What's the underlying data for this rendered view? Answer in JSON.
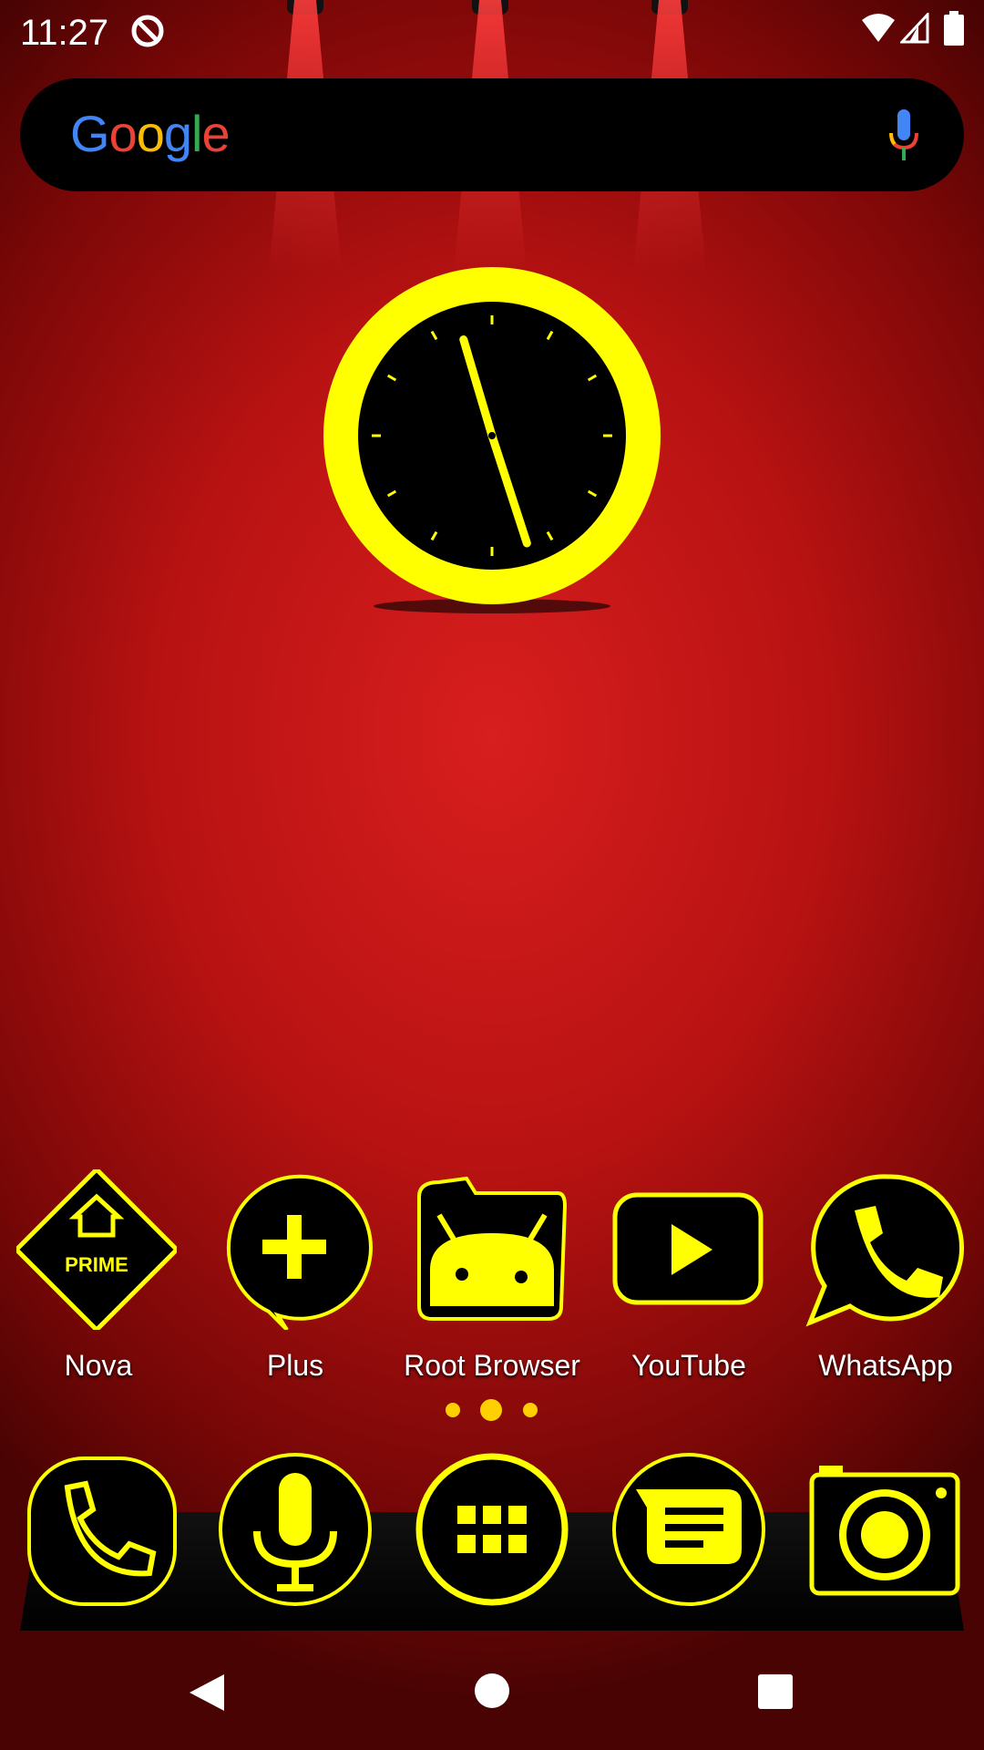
{
  "status_bar": {
    "time": "11:27",
    "notification_icon": "q-badge-icon",
    "icons": [
      "wifi-icon",
      "signal-icon",
      "battery-icon"
    ]
  },
  "search": {
    "logo": "Google",
    "mic_icon": "mic-icon"
  },
  "clock": {
    "hour": 11,
    "minute": 27,
    "ring_color": "#ffff00",
    "face_color": "#000000"
  },
  "apps": [
    {
      "label": "Nova",
      "icon": "nova-prime-icon"
    },
    {
      "label": "Plus",
      "icon": "plus-icon"
    },
    {
      "label": "Root Browser",
      "icon": "root-browser-icon"
    },
    {
      "label": "YouTube",
      "icon": "youtube-icon"
    },
    {
      "label": "WhatsApp",
      "icon": "whatsapp-icon"
    }
  ],
  "nova_badge": "PRIME",
  "page_indicator": {
    "pages": 3,
    "current": 2
  },
  "dock": [
    {
      "icon": "phone-icon"
    },
    {
      "icon": "mic-icon"
    },
    {
      "icon": "app-drawer-icon"
    },
    {
      "icon": "messages-icon"
    },
    {
      "icon": "camera-icon"
    }
  ],
  "nav": [
    "back-icon",
    "home-icon",
    "recents-icon"
  ],
  "colors": {
    "accent": "#ffff00",
    "background": "#c81818"
  }
}
